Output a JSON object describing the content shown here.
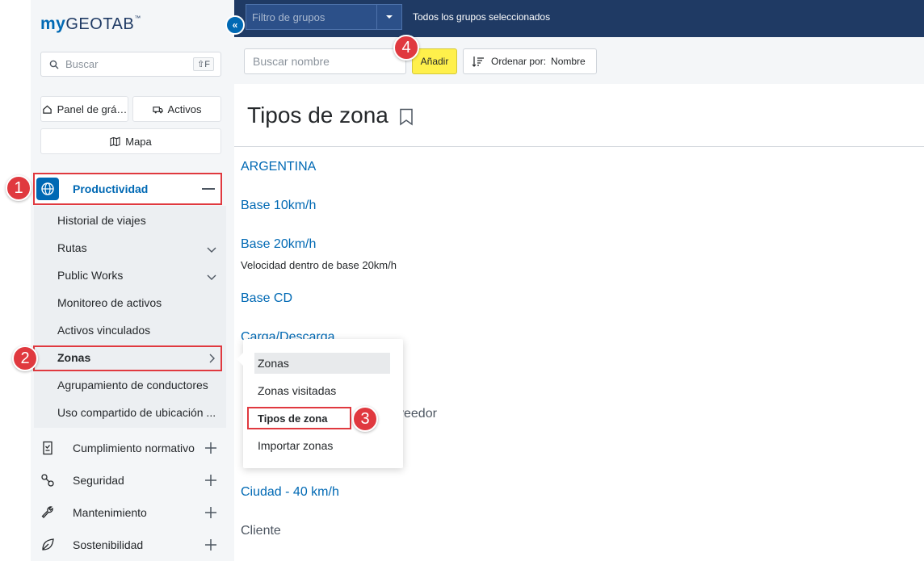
{
  "brand": {
    "my": "my",
    "name": "GEOTAB",
    "tm": "™"
  },
  "search": {
    "placeholder": "Buscar",
    "shortcut": "⇧F"
  },
  "quick": {
    "dashboard": "Panel de grá…",
    "assets": "Activos",
    "map": "Mapa"
  },
  "nav": {
    "productivity": "Productividad",
    "sub": [
      "Historial de viajes",
      "Rutas",
      "Public Works",
      "Monitoreo de activos",
      "Activos vinculados",
      "Zonas",
      "Agrupamiento de conductores",
      "Uso compartido de ubicación ..."
    ],
    "groups": [
      "Cumplimiento normativo",
      "Seguridad",
      "Mantenimiento",
      "Sostenibilidad"
    ]
  },
  "topbar": {
    "filter_placeholder": "Filtro de grupos",
    "status": "Todos los grupos seleccionados"
  },
  "toolbar": {
    "search_placeholder": "Buscar nombre",
    "add": "Añadir",
    "sort_label": "Ordenar por:",
    "sort_value": "Nombre"
  },
  "page": {
    "title": "Tipos de zona"
  },
  "zones": {
    "argentina": "ARGENTINA",
    "base10": "Base 10km/h",
    "base20": "Base 20km/h",
    "base20_desc": "Velocidad dentro de base 20km/h",
    "basecd": "Base CD",
    "carga": "Carga/Descarga",
    "partial": "veedor",
    "ciudad": "Ciudad - 40 km/h",
    "cliente": "Cliente"
  },
  "flyout": {
    "items": [
      "Zonas",
      "Zonas visitadas",
      "Tipos de zona",
      "Importar zonas"
    ]
  },
  "markers": [
    "1",
    "2",
    "3",
    "4"
  ],
  "colors": {
    "accent": "#0069b4",
    "topbar": "#1f3a64",
    "add_button": "#fff04b",
    "annotation": "#e0393f"
  }
}
